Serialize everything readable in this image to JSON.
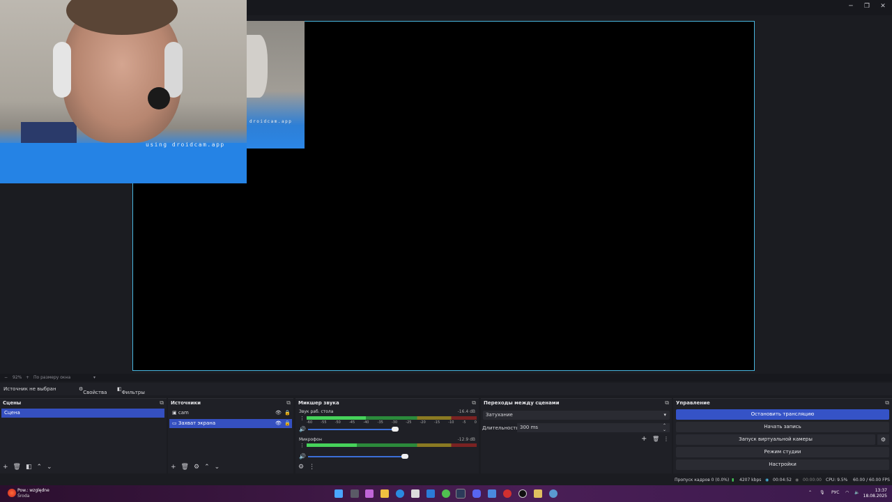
{
  "window": {
    "minimize_glyph": "─",
    "maximize_glyph": "❐",
    "close_glyph": "✕"
  },
  "preview": {
    "watermark_main": "using droidcam.app",
    "watermark_small": "droidcam.app"
  },
  "zoom": {
    "minus": "−",
    "value": "92%",
    "plus": "+",
    "mode": "По размеру окна",
    "dropdown_glyph": "▾"
  },
  "source_bar": {
    "status": "Источник не выбран",
    "properties_label": "Свойства",
    "filters_label": "Фильтры"
  },
  "scenes": {
    "title": "Сцены",
    "items": [
      "Сцена"
    ],
    "menu_glyph": "⧉"
  },
  "sources": {
    "title": "Источники",
    "items": [
      "cam",
      "Захват экрана"
    ],
    "menu_glyph": "⧉"
  },
  "mixer": {
    "title": "Микшер звука",
    "channels": [
      {
        "name": "Звук раб. стола",
        "db": "-16.4 dB",
        "level": 0.5
      },
      {
        "name": "Микрофон",
        "db": "-12.9 dB",
        "level": 0.4
      }
    ],
    "scale": [
      "-60",
      "-55",
      "-50",
      "-45",
      "-40",
      "-35",
      "-30",
      "-25",
      "-20",
      "-15",
      "-10",
      "-5",
      "0"
    ],
    "menu_glyph": "⧉"
  },
  "transitions": {
    "title": "Переходы между сценами",
    "selected": "Затухание",
    "duration_label": "Длительность",
    "duration_value": "300 ms",
    "menu_glyph": "⧉"
  },
  "controls": {
    "title": "Управление",
    "buttons": [
      "Остановить трансляцию",
      "Начать запись",
      "Запуск виртуальной камеры",
      "Режим студии",
      "Настройки"
    ],
    "menu_glyph": "⧉"
  },
  "status": {
    "dropped": "Пропуск кадров 0 (0.0%)",
    "bitrate": "4207 kbps",
    "stream_time": "00:04:52",
    "record_time": "00:00:00",
    "cpu": "CPU: 9.5%",
    "fps": "60.00 / 60.00 FPS"
  },
  "taskbar": {
    "weather_line1": "Pow.: względne",
    "weather_line2": "Środa",
    "lang": "РУС",
    "time": "13:37",
    "date": "18.08.2025"
  },
  "colors": {
    "accent": "#3553c7",
    "canvas_border": "#49b7e0"
  }
}
